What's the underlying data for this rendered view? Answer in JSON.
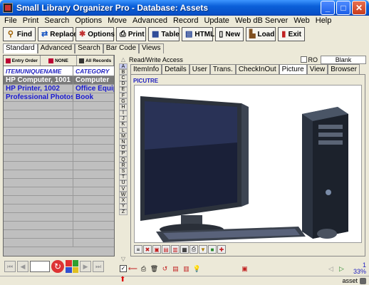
{
  "window": {
    "title": "Small Library Organizer Pro - Database: Assets"
  },
  "menu": [
    "File",
    "Print",
    "Search",
    "Options",
    "Move",
    "Advanced",
    "Record",
    "Update",
    "Web dB Server",
    "Web",
    "Help"
  ],
  "toolbar": [
    {
      "label": "Find",
      "icon": "search-icon"
    },
    {
      "label": "Replace",
      "icon": "replace-icon"
    },
    {
      "label": "Options",
      "icon": "options-icon"
    },
    {
      "label": "Print",
      "icon": "printer-icon"
    },
    {
      "label": "Table",
      "icon": "table-icon"
    },
    {
      "label": "HTML",
      "icon": "html-icon"
    },
    {
      "label": "New",
      "icon": "new-document-icon"
    },
    {
      "label": "Load",
      "icon": "load-icon"
    },
    {
      "label": "Exit",
      "icon": "exit-icon"
    }
  ],
  "view_tabs": [
    "Standard",
    "Advanced",
    "Search",
    "Bar Code",
    "Views"
  ],
  "sort_buttons": [
    "Entry Order",
    "NONE",
    "All Records"
  ],
  "list": {
    "columns": [
      "ITEMUNIQUENAME",
      "CATEGORY"
    ],
    "rows": [
      {
        "name": "HP Computer, 1001",
        "category": "Computer",
        "selected": true
      },
      {
        "name": "HP Printer, 1002",
        "category": "Office Equip",
        "selected": false
      },
      {
        "name": "Professional Photoshop",
        "category": "Book",
        "selected": false
      }
    ]
  },
  "alphabet": [
    "A",
    "B",
    "C",
    "D",
    "E",
    "F",
    "G",
    "H",
    "I",
    "J",
    "K",
    "L",
    "M",
    "N",
    "O",
    "P",
    "Q",
    "R",
    "S",
    "T",
    "U",
    "V",
    "W",
    "X",
    "Y",
    "Z"
  ],
  "right_header": {
    "access": "Read/Write Access",
    "ro_label": "RO",
    "blank_label": "Blank"
  },
  "detail_tabs": [
    "ItemInfo",
    "Details",
    "User",
    "Trans.",
    "CheckInOut",
    "Picture",
    "View",
    "Browser"
  ],
  "active_detail_tab": "Picture",
  "picture_label": "PICUTRE",
  "status": {
    "counter_top": "1",
    "counter_bottom": "33%",
    "db_name": "asset"
  },
  "colors": {
    "title_bar": "#0a5fd8",
    "list_text": "#1a1ad0",
    "selected_row": "#7a7a7a",
    "panel_bg": "#ece9d8"
  }
}
